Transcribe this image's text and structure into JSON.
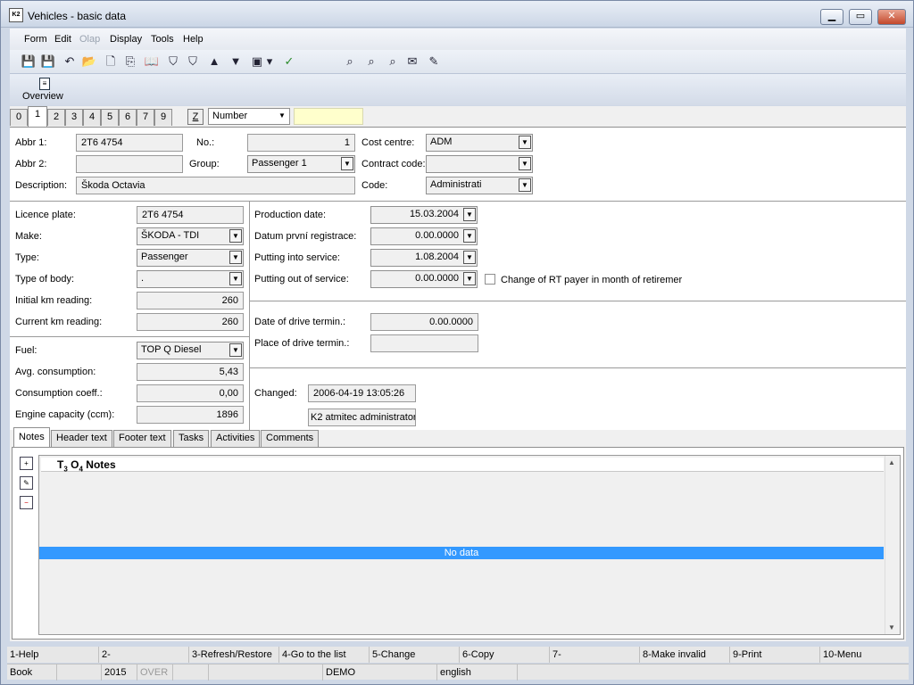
{
  "window": {
    "title": "Vehicles - basic data",
    "icon_text": "K2",
    "min_symbol": "▁",
    "max_symbol": "▭",
    "close_symbol": "✕"
  },
  "menu": [
    {
      "label": "Form",
      "enabled": true
    },
    {
      "label": "Edit",
      "enabled": true
    },
    {
      "label": "Olap",
      "enabled": false
    },
    {
      "label": "Display",
      "enabled": true
    },
    {
      "label": "Tools",
      "enabled": true
    },
    {
      "label": "Help",
      "enabled": true
    }
  ],
  "toolbar": {
    "icons": [
      "save-icon",
      "save-as-icon",
      "undo-icon",
      "open-folder-icon",
      "new-document-icon",
      "copy-icon",
      "book-icon",
      "filter-icon",
      "filter-doc-icon",
      "arrow-up-icon",
      "arrow-down-icon",
      "camera-icon",
      "dropdown-icon",
      "export-icon",
      "binoculars-icon",
      "find-next-icon",
      "find-replace-icon",
      "mail-icon",
      "notes-icon"
    ],
    "glyphs": [
      "💾",
      "💾",
      "↶",
      "📂",
      "🗋",
      "⎘",
      "📖",
      "⛉",
      "⛉",
      "▲",
      "▼",
      "▣",
      "▾",
      "✓",
      "⌕",
      "⌕",
      "⌕",
      "✉",
      "✎"
    ]
  },
  "ribbon": {
    "overview_label": "Overview",
    "overview_icon_glyph": "≡"
  },
  "page_tabs": [
    "0",
    "1",
    "2",
    "3",
    "4",
    "5",
    "6",
    "7",
    "9"
  ],
  "active_page_tab": "1",
  "sort": {
    "z_label": "Z",
    "field": "Number",
    "arrow": "▼"
  },
  "header": {
    "abbr1_label": "Abbr 1:",
    "abbr1": "2T6 4754",
    "abbr2_label": "Abbr 2:",
    "abbr2": "",
    "description_label": "Description:",
    "description": "Škoda Octavia",
    "no_label": "No.:",
    "no": "1",
    "group_label": "Group:",
    "group": "Passenger 1",
    "cost_centre_label": "Cost centre:",
    "cost_centre": "ADM",
    "contract_code_label": "Contract code:",
    "contract_code": "",
    "code_label": "Code:",
    "code": "Administrati"
  },
  "vehicle": {
    "licence_plate_label": "Licence plate:",
    "licence_plate": "2T6 4754",
    "make_label": "Make:",
    "make": "ŠKODA - TDI",
    "type_label": "Type:",
    "type": "Passenger",
    "type_of_body_label": "Type of body:",
    "type_of_body": ".",
    "initial_km_label": "Initial km reading:",
    "initial_km": "260",
    "current_km_label": "Current km reading:",
    "current_km": "260",
    "fuel_label": "Fuel:",
    "fuel": "TOP Q Diesel",
    "avg_consumption_label": "Avg. consumption:",
    "avg_consumption": "5,43",
    "consumption_coeff_label": "Consumption coeff.:",
    "consumption_coeff": "0,00",
    "engine_capacity_label": "Engine capacity (ccm):",
    "engine_capacity": "1896"
  },
  "dates": {
    "production_date_label": "Production date:",
    "production_date": "15.03.2004",
    "first_registration_label": "Datum první registrace:",
    "first_registration": "0.00.0000",
    "into_service_label": "Putting into service:",
    "into_service": "1.08.2004",
    "out_of_service_label": "Putting out of service:",
    "out_of_service": "0.00.0000",
    "rt_payer_label": "Change of RT payer in month of retiremer",
    "drive_termin_date_label": "Date of drive termin.:",
    "drive_termin_date": "0.00.0000",
    "drive_termin_place_label": "Place of drive termin.:",
    "drive_termin_place": "",
    "changed_label": "Changed:",
    "changed": "2006-04-19 13:05:26",
    "changed_by": "K2 atmitec administrator"
  },
  "bottom_tabs": [
    "Notes",
    "Header text",
    "Footer text",
    "Tasks",
    "Activities",
    "Comments"
  ],
  "active_bottom_tab": "Notes",
  "notes": {
    "header_t": "T",
    "header_t_sub": "3",
    "header_o": "O",
    "header_o_sub": "4",
    "header_title": "Notes",
    "no_data": "No data",
    "side_icons": [
      "add-note-icon",
      "edit-note-icon",
      "delete-note-icon"
    ]
  },
  "fkeys": [
    "1-Help",
    "2-",
    "3-Refresh/Restore",
    "4-Go to the list",
    "5-Change",
    "6-Copy",
    "7-",
    "8-Make invalid",
    "9-Print",
    "10-Menu"
  ],
  "status": {
    "book": "Book",
    "year": "2015",
    "over": "OVER",
    "db": "DEMO",
    "language": "english"
  }
}
